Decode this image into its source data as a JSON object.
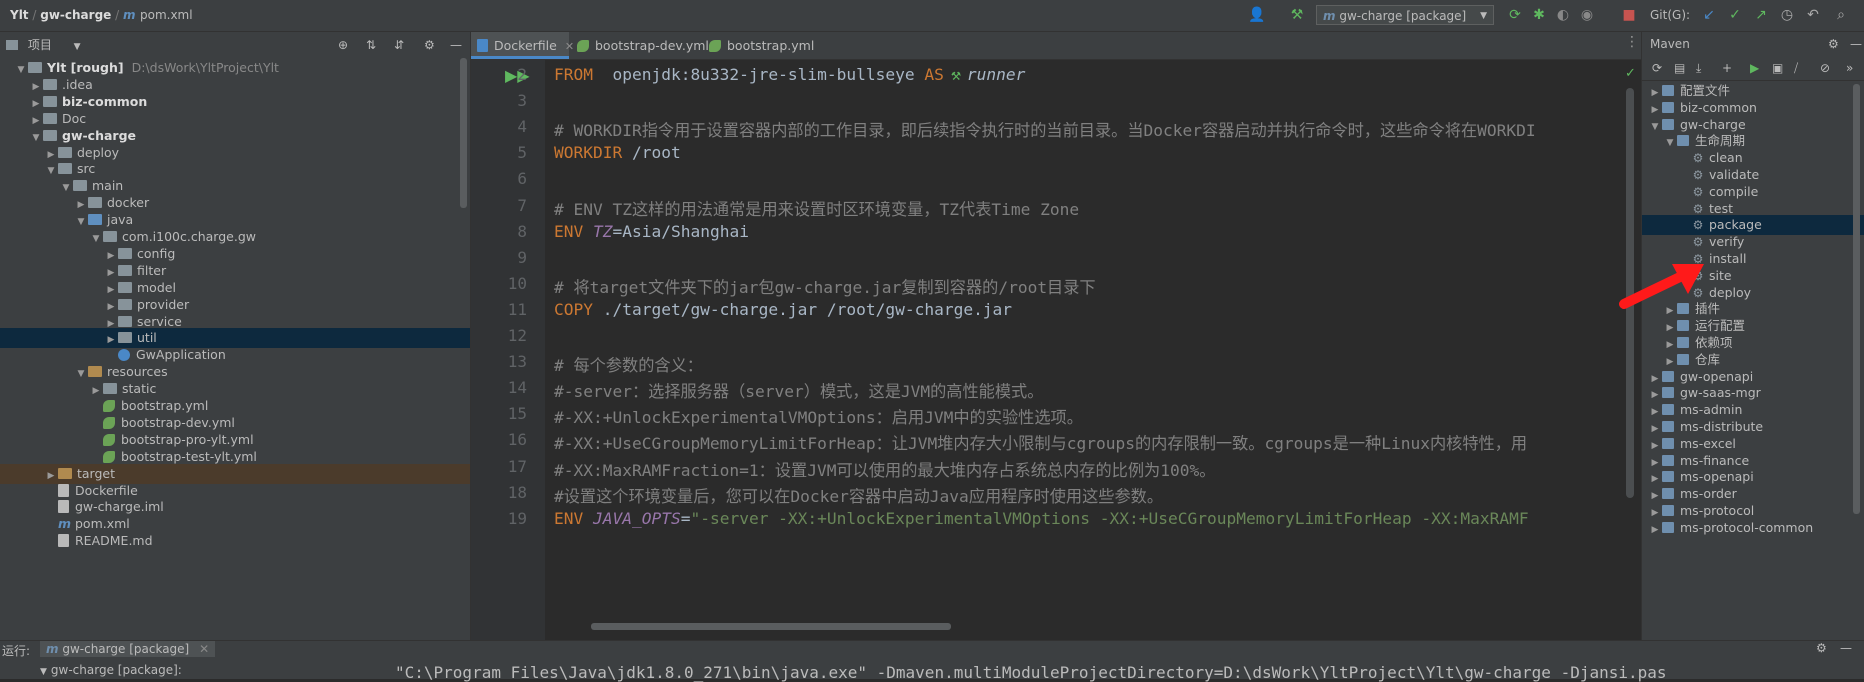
{
  "topbar": {
    "project_name": "Ylt",
    "module_name": "gw-charge",
    "file_name": "pom.xml",
    "run_config": "gw-charge [package]",
    "git_label": "Git(G):"
  },
  "project_panel": {
    "title": "项目",
    "tree": [
      {
        "label": "Ylt [rough]",
        "extra": "D:\\dsWork\\YltProject\\Ylt",
        "level": 0,
        "kind": "module",
        "expanded": true,
        "bold": true
      },
      {
        "label": ".idea",
        "level": 1,
        "kind": "folder",
        "expanded": false
      },
      {
        "label": "biz-common",
        "level": 1,
        "kind": "module",
        "expanded": false,
        "bold": true
      },
      {
        "label": "Doc",
        "level": 1,
        "kind": "folder",
        "expanded": false
      },
      {
        "label": "gw-charge",
        "level": 1,
        "kind": "module",
        "expanded": true,
        "bold": true
      },
      {
        "label": "deploy",
        "level": 2,
        "kind": "folder",
        "expanded": false
      },
      {
        "label": "src",
        "level": 2,
        "kind": "folder",
        "expanded": true
      },
      {
        "label": "main",
        "level": 3,
        "kind": "folder",
        "expanded": true
      },
      {
        "label": "docker",
        "level": 4,
        "kind": "folder",
        "expanded": false
      },
      {
        "label": "java",
        "level": 4,
        "kind": "source",
        "expanded": true
      },
      {
        "label": "com.i100c.charge.gw",
        "level": 5,
        "kind": "package",
        "expanded": true
      },
      {
        "label": "config",
        "level": 6,
        "kind": "package",
        "expanded": false
      },
      {
        "label": "filter",
        "level": 6,
        "kind": "package",
        "expanded": false
      },
      {
        "label": "model",
        "level": 6,
        "kind": "package",
        "expanded": false
      },
      {
        "label": "provider",
        "level": 6,
        "kind": "package",
        "expanded": false
      },
      {
        "label": "service",
        "level": 6,
        "kind": "package",
        "expanded": false
      },
      {
        "label": "util",
        "level": 6,
        "kind": "package",
        "expanded": false,
        "selected": true
      },
      {
        "label": "GwApplication",
        "level": 6,
        "kind": "java"
      },
      {
        "label": "resources",
        "level": 4,
        "kind": "resource",
        "expanded": true
      },
      {
        "label": "static",
        "level": 5,
        "kind": "folder",
        "expanded": false
      },
      {
        "label": "bootstrap.yml",
        "level": 5,
        "kind": "yml"
      },
      {
        "label": "bootstrap-dev.yml",
        "level": 5,
        "kind": "yml"
      },
      {
        "label": "bootstrap-pro-ylt.yml",
        "level": 5,
        "kind": "yml"
      },
      {
        "label": "bootstrap-test-ylt.yml",
        "level": 5,
        "kind": "yml"
      },
      {
        "label": "target",
        "level": 2,
        "kind": "target",
        "expanded": false,
        "highlight": true
      },
      {
        "label": "Dockerfile",
        "level": 2,
        "kind": "file"
      },
      {
        "label": "gw-charge.iml",
        "level": 2,
        "kind": "file"
      },
      {
        "label": "pom.xml",
        "level": 2,
        "kind": "maven"
      },
      {
        "label": "README.md",
        "level": 2,
        "kind": "file"
      }
    ]
  },
  "editor": {
    "tabs": [
      {
        "label": "Dockerfile",
        "active": true
      },
      {
        "label": "bootstrap-dev.yml",
        "active": false
      },
      {
        "label": "bootstrap.yml",
        "active": false
      }
    ],
    "lines": [
      {
        "n": "2",
        "segs": [
          [
            "kw",
            "FROM"
          ],
          [
            "",
            "  openjdk:8u332-jre-slim-bullseye "
          ],
          [
            "kw",
            "AS"
          ],
          [
            "",
            "   "
          ],
          [
            "it",
            "runner"
          ]
        ]
      },
      {
        "n": "3",
        "segs": []
      },
      {
        "n": "4",
        "segs": [
          [
            "cm",
            "# WORKDIR指令用于设置容器内部的工作目录，即后续指令执行时的当前目录。当Docker容器启动并执行命令时，这些命令将在WORKDI"
          ]
        ]
      },
      {
        "n": "5",
        "segs": [
          [
            "kw",
            "WORKDIR"
          ],
          [
            "",
            " /root"
          ]
        ]
      },
      {
        "n": "6",
        "segs": []
      },
      {
        "n": "7",
        "segs": [
          [
            "cm",
            "# ENV TZ这样的用法通常是用来设置时区环境变量，TZ代表Time Zone"
          ]
        ]
      },
      {
        "n": "8",
        "segs": [
          [
            "kw",
            "ENV"
          ],
          [
            "",
            " "
          ],
          [
            "var",
            "TZ"
          ],
          [
            "",
            "=Asia/Shanghai"
          ]
        ]
      },
      {
        "n": "9",
        "segs": []
      },
      {
        "n": "10",
        "segs": [
          [
            "cm",
            "# 将target文件夹下的jar包gw-charge.jar复制到容器的/root目录下"
          ]
        ]
      },
      {
        "n": "11",
        "segs": [
          [
            "kw",
            "COPY"
          ],
          [
            "",
            " ./target/gw-charge.jar /root/gw-charge.jar"
          ]
        ]
      },
      {
        "n": "12",
        "segs": []
      },
      {
        "n": "13",
        "segs": [
          [
            "cm",
            "# 每个参数的含义："
          ]
        ]
      },
      {
        "n": "14",
        "segs": [
          [
            "cm",
            "#-server：选择服务器（server）模式，这是JVM的高性能模式。"
          ]
        ]
      },
      {
        "n": "15",
        "segs": [
          [
            "cm",
            "#-XX:+UnlockExperimentalVMOptions：启用JVM中的实验性选项。"
          ]
        ]
      },
      {
        "n": "16",
        "segs": [
          [
            "cm",
            "#-XX:+UseCGroupMemoryLimitForHeap：让JVM堆内存大小限制与cgroups的内存限制一致。cgroups是一种Linux内核特性，用"
          ]
        ]
      },
      {
        "n": "17",
        "segs": [
          [
            "cm",
            "#-XX:MaxRAMFraction=1：设置JVM可以使用的最大堆内存占系统总内存的比例为100%。"
          ]
        ]
      },
      {
        "n": "18",
        "segs": [
          [
            "cm",
            "#设置这个环境变量后，您可以在Docker容器中启动Java应用程序时使用这些参数。"
          ]
        ]
      },
      {
        "n": "19",
        "segs": [
          [
            "kw",
            "ENV"
          ],
          [
            "",
            " "
          ],
          [
            "var",
            "JAVA_OPTS"
          ],
          [
            "",
            "="
          ],
          [
            "str",
            "\"-server -XX:+UnlockExperimentalVMOptions -XX:+UseCGroupMemoryLimitForHeap -XX:MaxRAMF"
          ]
        ]
      }
    ]
  },
  "maven_panel": {
    "title": "Maven",
    "tree": [
      {
        "label": "配置文件",
        "level": 0,
        "kind": "folder",
        "expanded": false
      },
      {
        "label": "biz-common",
        "level": 0,
        "kind": "module",
        "expanded": false
      },
      {
        "label": "gw-charge",
        "level": 0,
        "kind": "module",
        "expanded": true
      },
      {
        "label": "生命周期",
        "level": 1,
        "kind": "folder",
        "expanded": true
      },
      {
        "label": "clean",
        "level": 2,
        "kind": "goal"
      },
      {
        "label": "validate",
        "level": 2,
        "kind": "goal"
      },
      {
        "label": "compile",
        "level": 2,
        "kind": "goal"
      },
      {
        "label": "test",
        "level": 2,
        "kind": "goal"
      },
      {
        "label": "package",
        "level": 2,
        "kind": "goal",
        "selected": true
      },
      {
        "label": "verify",
        "level": 2,
        "kind": "goal"
      },
      {
        "label": "install",
        "level": 2,
        "kind": "goal"
      },
      {
        "label": "site",
        "level": 2,
        "kind": "goal"
      },
      {
        "label": "deploy",
        "level": 2,
        "kind": "goal"
      },
      {
        "label": "插件",
        "level": 1,
        "kind": "folder",
        "expanded": false
      },
      {
        "label": "运行配置",
        "level": 1,
        "kind": "folder",
        "expanded": false
      },
      {
        "label": "依赖项",
        "level": 1,
        "kind": "folder",
        "expanded": false
      },
      {
        "label": "仓库",
        "level": 1,
        "kind": "folder",
        "expanded": false
      },
      {
        "label": "gw-openapi",
        "level": 0,
        "kind": "module",
        "expanded": false
      },
      {
        "label": "gw-saas-mgr",
        "level": 0,
        "kind": "module",
        "expanded": false
      },
      {
        "label": "ms-admin",
        "level": 0,
        "kind": "module",
        "expanded": false
      },
      {
        "label": "ms-distribute",
        "level": 0,
        "kind": "module",
        "expanded": false
      },
      {
        "label": "ms-excel",
        "level": 0,
        "kind": "module",
        "expanded": false
      },
      {
        "label": "ms-finance",
        "level": 0,
        "kind": "module",
        "expanded": false
      },
      {
        "label": "ms-openapi",
        "level": 0,
        "kind": "module",
        "expanded": false
      },
      {
        "label": "ms-order",
        "level": 0,
        "kind": "module",
        "expanded": false
      },
      {
        "label": "ms-protocol",
        "level": 0,
        "kind": "module",
        "expanded": false
      },
      {
        "label": "ms-protocol-common",
        "level": 0,
        "kind": "module",
        "expanded": false
      }
    ]
  },
  "bottom": {
    "run_label": "运行:",
    "run_tab": "gw-charge [package]",
    "run_item": "gw-charge [package]:",
    "console_text": "\"C:\\Program Files\\Java\\jdk1.8.0_271\\bin\\java.exe\" -Dmaven.multiModuleProjectDirectory=D:\\dsWork\\YltProject\\Ylt\\gw-charge -Djansi.pas"
  },
  "colors": {
    "accent": "#4a88c7",
    "selection": "#0d293e",
    "annotation_arrow": "#ff1a1a"
  }
}
